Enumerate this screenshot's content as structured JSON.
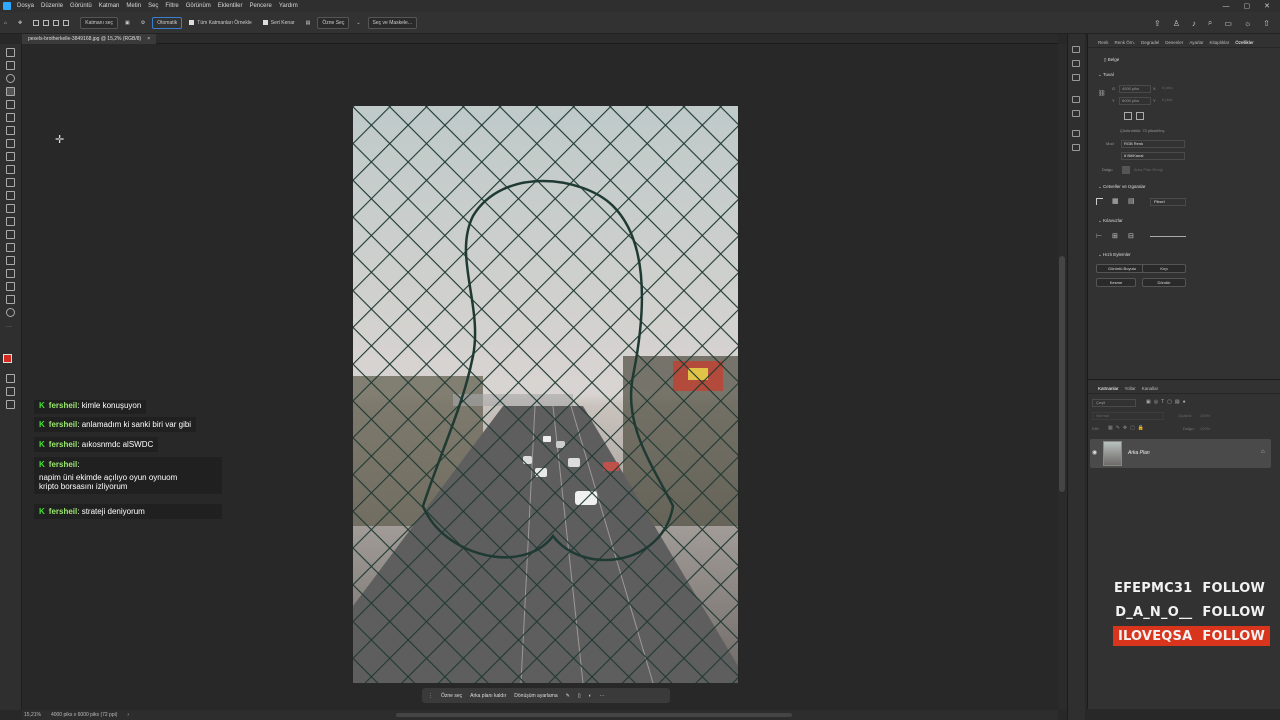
{
  "menu": [
    "Dosya",
    "Düzenle",
    "Görüntü",
    "Katman",
    "Metin",
    "Seç",
    "Filtre",
    "Görünüm",
    "Eklentiler",
    "Pencere",
    "Yardım"
  ],
  "options": {
    "layer_select": "Katmanı seç",
    "mode": "Otomatik",
    "sample_all": "Tüm Katmanları Örnekle",
    "hard_edge": "Sert Kenar",
    "select_subject": "Özne Seç",
    "select_mask": "Seç ve Maskele..."
  },
  "document": {
    "tab_title": "pexels-brotherkelle-3849168.jpg @ 15,2% (RGB/8)"
  },
  "properties": {
    "tabs": [
      "Renk",
      "Renk Örn.",
      "Degradel",
      "Desenler",
      "Ayarlar",
      "Kitaplıklar",
      "Özellikler"
    ],
    "doc_label": "Belge",
    "canvas_section": "Tuval",
    "w_label": "G",
    "h_label": "Y",
    "width": "4000 piks",
    "height": "6000 piks",
    "x_label": "X",
    "y_label": "Y",
    "x_val": "0 piks",
    "y_val": "0 piks",
    "resolution": "Çözünürlük: 72 piksel/inç",
    "mode_label": "Mod",
    "mode_val": "RGB Renk",
    "depth_val": "8 Bit/Kanal",
    "fill_label": "Dolgu",
    "fill_val": "Arka Plan Rengi",
    "rulers_section": "Cetveller ve Izgaralar",
    "unit_val": "Piksel",
    "guides_section": "Kılavuzlar",
    "quick_section": "Hızlı Eylemler",
    "btn_canvas_size": "Görüntü Boyutu",
    "btn_crop": "Kırp",
    "btn_trim": "Kesme",
    "btn_rotate": "Döndür"
  },
  "layers": {
    "tabs": [
      "Katmanlar",
      "Yollar",
      "Kanallar"
    ],
    "search": "Çeşit",
    "blend": "Normal",
    "opacity_label": "Opaklık:",
    "opacity_val": "100%",
    "lock_label": "Kilit:",
    "fill_label": "Dolgu:",
    "fill_val": "100%",
    "layer_name": "Arka Plan"
  },
  "chat": [
    {
      "user": "fersheil",
      "text": "kimle konuşuyon"
    },
    {
      "user": "fersheil",
      "text": "anlamadım ki sanki biri var gibi"
    },
    {
      "user": "fersheil",
      "text": "aıkosnmdc alSWDC"
    },
    {
      "user": "fersheil",
      "text": "",
      "lines": [
        "napim üni ekimde açılıyo oyun oynuom",
        "kripto borsasını izliyorum"
      ]
    },
    {
      "user": "fersheil",
      "text": "strateji deniyorum"
    }
  ],
  "follows": [
    {
      "name": "EFEPMC31",
      "action": "FOLLOW",
      "highlight": false
    },
    {
      "name": "D_A_N_O__",
      "action": "FOLLOW",
      "highlight": false
    },
    {
      "name": "ILOVEQSA",
      "action": "FOLLOW",
      "highlight": true
    }
  ],
  "context_bar": {
    "select_subject": "Özne seç",
    "remove_bg": "Arka planı kaldır",
    "transform": "Dönüşüm ayarlama"
  },
  "status": {
    "zoom": "15,21%",
    "size": "4000 piks x 6000 piks (72 ppi)"
  },
  "colors": {
    "accent": "#31a8ff",
    "follow_highlight": "#d9341c",
    "chat_badge": "#3ee62e"
  }
}
